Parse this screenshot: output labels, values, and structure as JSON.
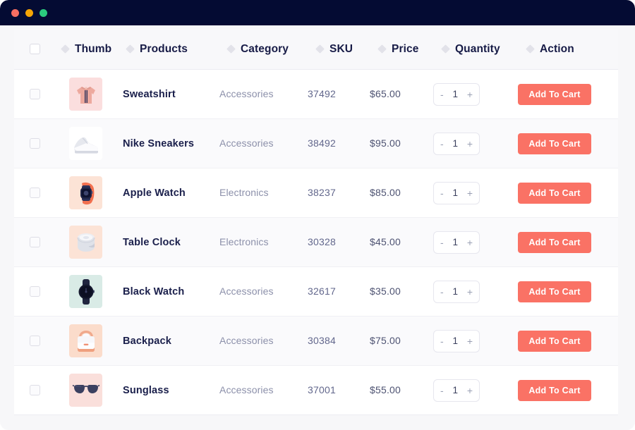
{
  "window": {
    "titlebar_buttons": [
      {
        "name": "close",
        "color": "#f96f62"
      },
      {
        "name": "minimize",
        "color": "#f5a505"
      },
      {
        "name": "maximize",
        "color": "#2bcc7e"
      }
    ]
  },
  "table": {
    "select_all_checked": false,
    "columns": [
      {
        "key": "thumb",
        "label": "Thumb",
        "sortable": true
      },
      {
        "key": "products",
        "label": "Products",
        "sortable": true
      },
      {
        "key": "category",
        "label": "Category",
        "sortable": true
      },
      {
        "key": "sku",
        "label": "SKU",
        "sortable": true
      },
      {
        "key": "price",
        "label": "Price",
        "sortable": true
      },
      {
        "key": "quantity",
        "label": "Quantity",
        "sortable": true
      },
      {
        "key": "action",
        "label": "Action",
        "sortable": true
      }
    ],
    "stepper": {
      "decrement_label": "-",
      "increment_label": "+"
    },
    "action_label": "Add To Cart",
    "rows": [
      {
        "checked": false,
        "thumb_icon": "sweatshirt-thumbnail",
        "thumb_bg": "#fbdede",
        "product": "Sweatshirt",
        "category": "Accessories",
        "sku": "37492",
        "price": "$65.00",
        "quantity": "1",
        "action": "Add To Cart"
      },
      {
        "checked": false,
        "thumb_icon": "sneaker-thumbnail",
        "thumb_bg": "#ffffff",
        "product": "Nike Sneakers",
        "category": "Accessories",
        "sku": "38492",
        "price": "$95.00",
        "quantity": "1",
        "action": "Add To Cart"
      },
      {
        "checked": false,
        "thumb_icon": "apple-watch-thumbnail",
        "thumb_bg": "#fce3d6",
        "product": "Apple Watch",
        "category": "Electronics",
        "sku": "38237",
        "price": "$85.00",
        "quantity": "1",
        "action": "Add To Cart"
      },
      {
        "checked": false,
        "thumb_icon": "table-clock-thumbnail",
        "thumb_bg": "#fce3d6",
        "product": "Table Clock",
        "category": "Electronics",
        "sku": "30328",
        "price": "$45.00",
        "quantity": "1",
        "action": "Add To Cart"
      },
      {
        "checked": false,
        "thumb_icon": "black-watch-thumbnail",
        "thumb_bg": "#d9ebe6",
        "product": "Black Watch",
        "category": "Accessories",
        "sku": "32617",
        "price": "$35.00",
        "quantity": "1",
        "action": "Add To Cart"
      },
      {
        "checked": false,
        "thumb_icon": "backpack-thumbnail",
        "thumb_bg": "#fbdccb",
        "product": "Backpack",
        "category": "Accessories",
        "sku": "30384",
        "price": "$75.00",
        "quantity": "1",
        "action": "Add To Cart"
      },
      {
        "checked": false,
        "thumb_icon": "sunglass-thumbnail",
        "thumb_bg": "#fadfdb",
        "product": "Sunglass",
        "category": "Accessories",
        "sku": "37001",
        "price": "$55.00",
        "quantity": "1",
        "action": "Add To Cart"
      }
    ]
  },
  "colors": {
    "titlebar": "#040b33",
    "page_bg": "#f7f7f9",
    "row_bg": "#ffffff",
    "row_alt_bg": "#fafafc",
    "header_bg": "#f8f8fa",
    "accent": "#fa7265",
    "heading_text": "#171b46",
    "muted_text": "#8c90aa"
  }
}
